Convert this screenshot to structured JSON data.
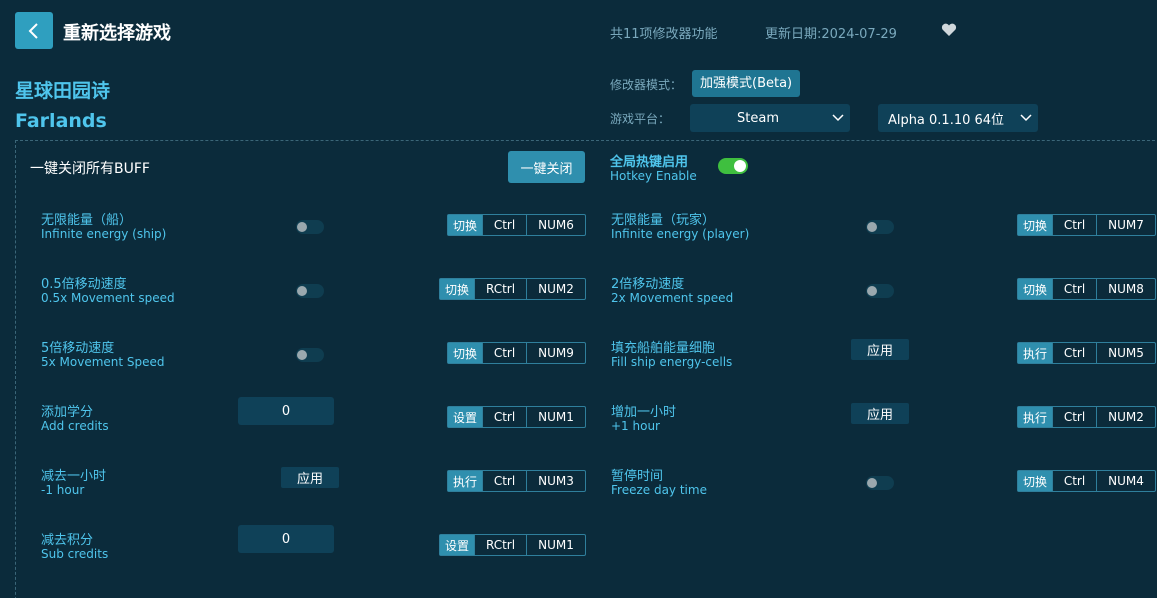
{
  "header": {
    "back_icon": "chevron-left-icon",
    "title": "重新选择游戏",
    "feature_count": "共11项修改器功能",
    "update_date": "更新日期:2024-07-29",
    "favorite_icon": "heart-icon"
  },
  "game": {
    "name_cn": "星球田园诗",
    "name_en": "Farlands"
  },
  "options": {
    "mode_label": "修改器模式：",
    "mode_value": "加强模式(Beta)",
    "platform_label": "游戏平台：",
    "platform_value": "Steam",
    "version_value": "Alpha 0.1.10 64位"
  },
  "controls": {
    "all_off_label": "一键关闭所有BUFF",
    "all_off_button": "一键关闭",
    "hotkey_cn": "全局热键启用",
    "hotkey_en": "Hotkey Enable",
    "hotkey_enabled": true
  },
  "cheats": [
    {
      "cn": "无限能量（船）",
      "en": "Infinite energy (ship)",
      "control": "toggle",
      "action": "切换",
      "mod": "Ctrl",
      "key": "NUM6"
    },
    {
      "cn": "无限能量（玩家）",
      "en": "Infinite energy (player)",
      "control": "toggle",
      "action": "切换",
      "mod": "Ctrl",
      "key": "NUM7"
    },
    {
      "cn": "0.5倍移动速度",
      "en": "0.5x Movement speed",
      "control": "toggle",
      "action": "切换",
      "mod": "RCtrl",
      "key": "NUM2"
    },
    {
      "cn": "2倍移动速度",
      "en": "2x Movement speed",
      "control": "toggle",
      "action": "切换",
      "mod": "Ctrl",
      "key": "NUM8"
    },
    {
      "cn": "5倍移动速度",
      "en": "5x Movement Speed",
      "control": "toggle",
      "action": "切换",
      "mod": "Ctrl",
      "key": "NUM9"
    },
    {
      "cn": "填充船舶能量细胞",
      "en": "Fill ship energy-cells",
      "control": "apply",
      "control_label": "应用",
      "action": "执行",
      "mod": "Ctrl",
      "key": "NUM5"
    },
    {
      "cn": "添加学分",
      "en": "Add credits",
      "control": "input",
      "value": "0",
      "action": "设置",
      "mod": "Ctrl",
      "key": "NUM1"
    },
    {
      "cn": "增加一小时",
      "en": "+1 hour",
      "control": "apply",
      "control_label": "应用",
      "action": "执行",
      "mod": "Ctrl",
      "key": "NUM2"
    },
    {
      "cn": "减去一小时",
      "en": "-1 hour",
      "control": "apply",
      "control_label": "应用",
      "action": "执行",
      "mod": "Ctrl",
      "key": "NUM3"
    },
    {
      "cn": "暂停时间",
      "en": "Freeze day time",
      "control": "toggle",
      "action": "切换",
      "mod": "Ctrl",
      "key": "NUM4"
    },
    {
      "cn": "减去积分",
      "en": "Sub credits",
      "control": "input",
      "value": "0",
      "action": "设置",
      "mod": "RCtrl",
      "key": "NUM1"
    }
  ],
  "colors": {
    "background": "#0b2b3b",
    "accent": "#2f9fbf",
    "label_cyan": "#4fc5ec",
    "toggle_on": "#3fbf3f"
  }
}
